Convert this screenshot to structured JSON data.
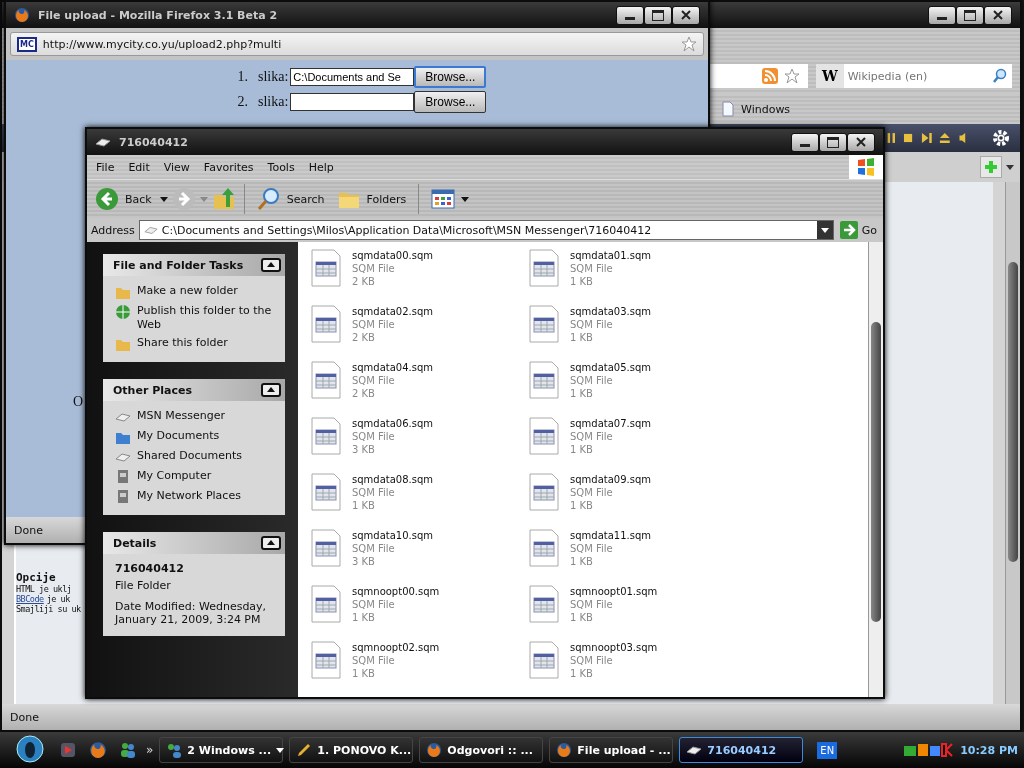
{
  "background_browser": {
    "search": {
      "engine": "W",
      "placeholder": "Wikipedia (en)"
    },
    "bookmark": "Windows",
    "options": {
      "heading": "Opcije",
      "lines": [
        {
          "kind": "text",
          "text": "HTML je uklj"
        },
        {
          "kind": "link",
          "link": "BBCode",
          "text": "je uk"
        },
        {
          "kind": "text",
          "text": "Smajliji su uk"
        }
      ]
    },
    "status": "Done"
  },
  "firefox": {
    "title": "File upload - Mozilla Firefox 3.1 Beta 2",
    "site_badge": "MC",
    "url": "http://www.mycity.co.yu/upload2.php?multi",
    "rows": [
      {
        "number": "1.",
        "label": "slika:",
        "value": "C:\\Documents and Se",
        "button": "Browse...",
        "focused": true
      },
      {
        "number": "2.",
        "label": "slika:",
        "button": "Browse...",
        "focused": false
      }
    ],
    "page_letter": "O",
    "status": "Done"
  },
  "explorer": {
    "title": "716040412",
    "menu": [
      "File",
      "Edit",
      "View",
      "Favorites",
      "Tools",
      "Help"
    ],
    "toolbar": {
      "back": "Back",
      "search": "Search",
      "folders": "Folders"
    },
    "address": {
      "label": "Address",
      "value": "C:\\Documents and Settings\\Milos\\Application Data\\Microsoft\\MSN Messenger\\716040412",
      "go": "Go"
    },
    "panels": [
      {
        "kind": "tasks",
        "title": "File and Folder Tasks",
        "expanded": true,
        "items": [
          {
            "label": "Make a new folder"
          },
          {
            "label": "Publish this folder to the Web"
          },
          {
            "label": "Share this folder"
          }
        ]
      },
      {
        "kind": "places",
        "title": "Other Places",
        "expanded": true,
        "items": [
          {
            "label": "MSN Messenger"
          },
          {
            "label": "My Documents"
          },
          {
            "label": "Shared Documents"
          },
          {
            "label": "My Computer"
          },
          {
            "label": "My Network Places"
          }
        ]
      },
      {
        "kind": "details",
        "title": "Details",
        "expanded": true,
        "name": "716040412",
        "type": "File Folder",
        "modified": "Date Modified: Wednesday, January 21, 2009, 3:24 PM"
      }
    ],
    "files": [
      {
        "name": "sqmdata00.sqm",
        "type": "SQM File",
        "size": "2 KB"
      },
      {
        "name": "sqmdata01.sqm",
        "type": "SQM File",
        "size": "1 KB"
      },
      {
        "name": "sqmdata02.sqm",
        "type": "SQM File",
        "size": "2 KB"
      },
      {
        "name": "sqmdata03.sqm",
        "type": "SQM File",
        "size": "1 KB"
      },
      {
        "name": "sqmdata04.sqm",
        "type": "SQM File",
        "size": "2 KB"
      },
      {
        "name": "sqmdata05.sqm",
        "type": "SQM File",
        "size": "1 KB"
      },
      {
        "name": "sqmdata06.sqm",
        "type": "SQM File",
        "size": "3 KB"
      },
      {
        "name": "sqmdata07.sqm",
        "type": "SQM File",
        "size": "1 KB"
      },
      {
        "name": "sqmdata08.sqm",
        "type": "SQM File",
        "size": "1 KB"
      },
      {
        "name": "sqmdata09.sqm",
        "type": "SQM File",
        "size": "1 KB"
      },
      {
        "name": "sqmdata10.sqm",
        "type": "SQM File",
        "size": "3 KB"
      },
      {
        "name": "sqmdata11.sqm",
        "type": "SQM File",
        "size": "1 KB"
      },
      {
        "name": "sqmnoopt00.sqm",
        "type": "SQM File",
        "size": "1 KB"
      },
      {
        "name": "sqmnoopt01.sqm",
        "type": "SQM File",
        "size": "1 KB"
      },
      {
        "name": "sqmnoopt02.sqm",
        "type": "SQM File",
        "size": "1 KB"
      },
      {
        "name": "sqmnoopt03.sqm",
        "type": "SQM File",
        "size": "1 KB"
      }
    ]
  },
  "taskbar": {
    "more": "»",
    "tasks": [
      {
        "label": "2 Windows ...",
        "group": true,
        "selected": false
      },
      {
        "label": "1. PONOVO K...",
        "group": false,
        "selected": false
      },
      {
        "label": "Odgovori :: ...",
        "group": false,
        "selected": false
      },
      {
        "label": "File upload - ...",
        "group": false,
        "selected": false
      },
      {
        "label": "716040412",
        "group": false,
        "selected": true
      }
    ],
    "language": "EN",
    "clock": "10:28 PM"
  }
}
